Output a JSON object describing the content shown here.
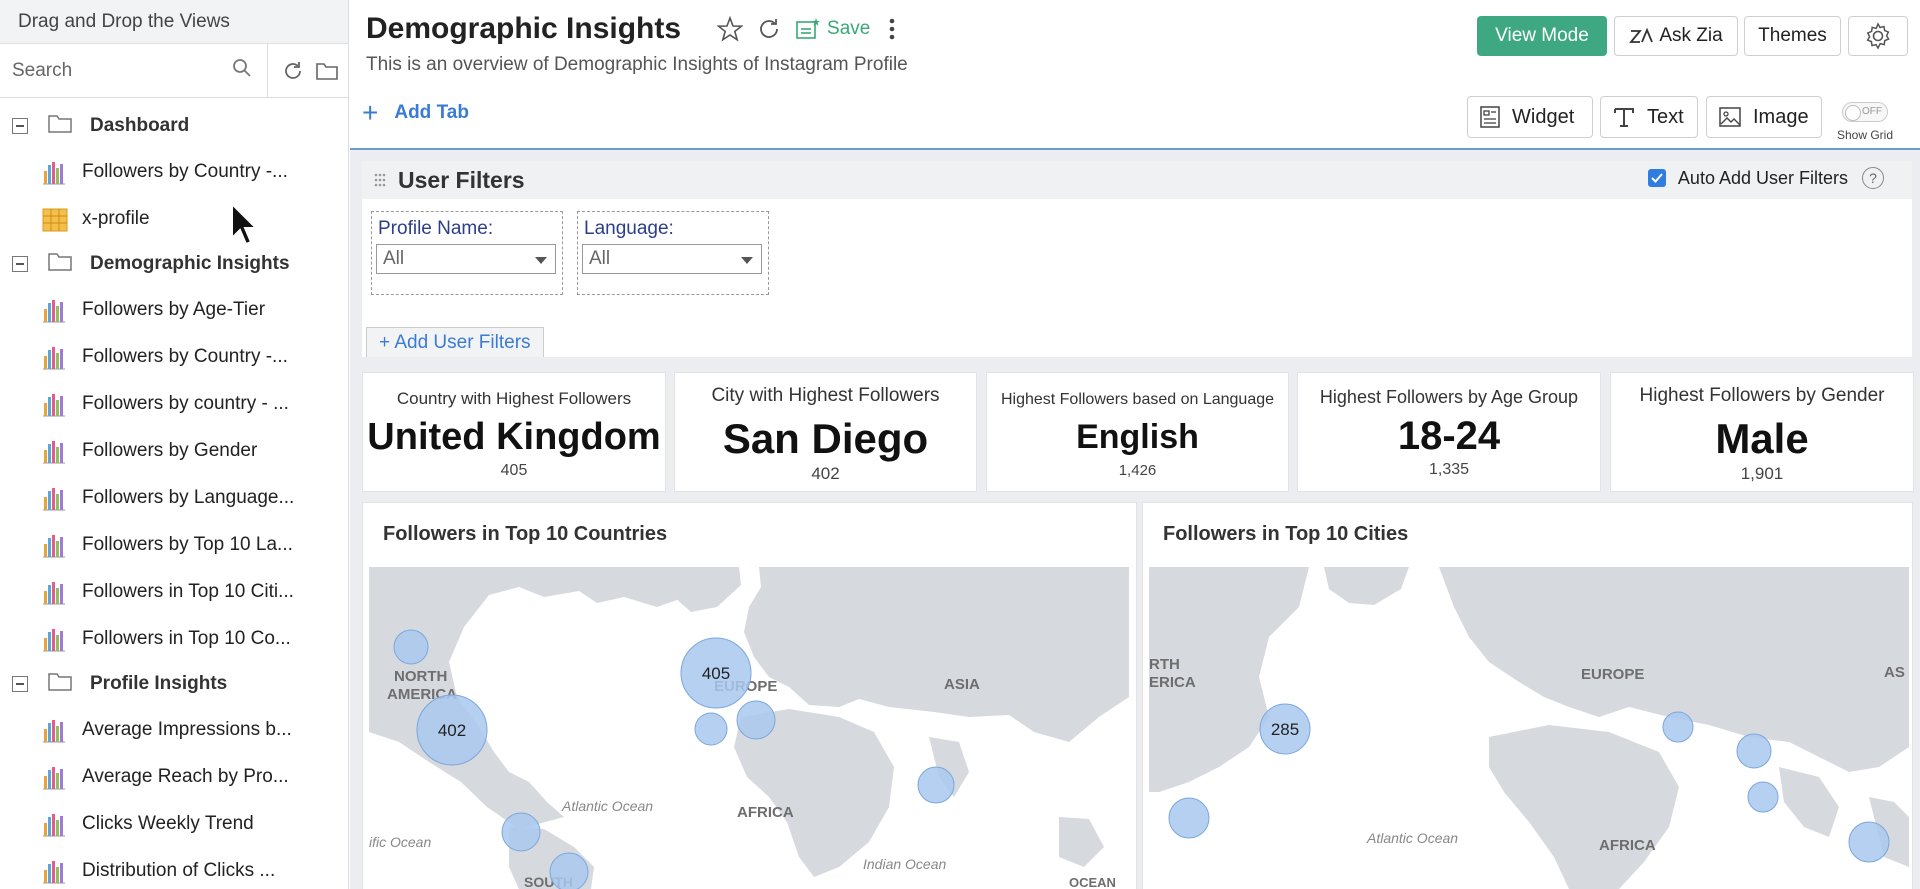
{
  "sidebar": {
    "header": "Drag and Drop the Views",
    "search_placeholder": "Search",
    "tree": [
      {
        "kind": "folder",
        "label": "Dashboard"
      },
      {
        "kind": "chart",
        "label": "Followers by Country -..."
      },
      {
        "kind": "table",
        "label": "x-profile"
      },
      {
        "kind": "folder",
        "label": "Demographic Insights"
      },
      {
        "kind": "chart",
        "label": "Followers by Age-Tier"
      },
      {
        "kind": "chart",
        "label": "Followers by Country -..."
      },
      {
        "kind": "chart",
        "label": "Followers by country - ..."
      },
      {
        "kind": "chart",
        "label": "Followers by Gender"
      },
      {
        "kind": "chart",
        "label": "Followers by Language..."
      },
      {
        "kind": "chart",
        "label": "Followers by Top 10 La..."
      },
      {
        "kind": "chart",
        "label": "Followers in Top 10 Citi..."
      },
      {
        "kind": "chart",
        "label": "Followers in Top 10 Co..."
      },
      {
        "kind": "folder",
        "label": "Profile Insights"
      },
      {
        "kind": "chart",
        "label": "Average Impressions b..."
      },
      {
        "kind": "chart",
        "label": "Average Reach by Pro..."
      },
      {
        "kind": "chart",
        "label": "Clicks Weekly Trend"
      },
      {
        "kind": "chart",
        "label": "Distribution of Clicks ..."
      }
    ]
  },
  "header": {
    "title": "Demographic Insights",
    "description": "This is an overview of Demographic Insights of Instagram Profile",
    "save_label": "Save",
    "view_mode_label": "View Mode",
    "ask_zia_label": "Ask Zia",
    "themes_label": "Themes"
  },
  "toolbar": {
    "add_tab_label": "Add Tab",
    "widget_label": "Widget",
    "text_label": "Text",
    "image_label": "Image",
    "toggle_state": "OFF",
    "show_grid_label": "Show Grid"
  },
  "filters": {
    "title": "User Filters",
    "auto_add_label": "Auto Add User Filters",
    "help_glyph": "?",
    "profile_label": "Profile Name:",
    "profile_value": "All",
    "language_label": "Language:",
    "language_value": "All",
    "add_filters_label": "+ Add User Filters"
  },
  "kpis": [
    {
      "title": "Country with Highest Followers",
      "value": "United Kingdom",
      "sub": "405"
    },
    {
      "title": "City with Highest Followers",
      "value": "San Diego",
      "sub": "402"
    },
    {
      "title": "Highest Followers based on Language",
      "value": "English",
      "sub": "1,426"
    },
    {
      "title": "Highest Followers by Age Group",
      "value": "18-24",
      "sub": "1,335"
    },
    {
      "title": "Highest Followers by Gender",
      "value": "Male",
      "sub": "1,901"
    }
  ],
  "maps": {
    "countries": {
      "title": "Followers in Top 10 Countries",
      "labels": {
        "north_america": "NORTH AMERICA",
        "europe": "EUROPE",
        "asia": "ASIA",
        "africa": "AFRICA",
        "atlantic": "Atlantic Ocean",
        "pacific": "ific Ocean",
        "indian": "Indian Ocean",
        "south": "SOUTH",
        "ocean_edge": "OCEAN"
      },
      "bubble_a": "405",
      "bubble_b": "402"
    },
    "cities": {
      "title": "Followers in Top 10 Cities",
      "labels": {
        "na_a": "RTH",
        "na_b": "ERICA",
        "europe": "EUROPE",
        "asia": "AS",
        "atlantic": "Atlantic Ocean",
        "africa": "AFRICA"
      },
      "bubble_a": "285"
    }
  },
  "colors": {
    "accent": "#3ea883",
    "link": "#3a7bd5",
    "bubble": "#a9c8ee",
    "land": "#d6d9de"
  }
}
